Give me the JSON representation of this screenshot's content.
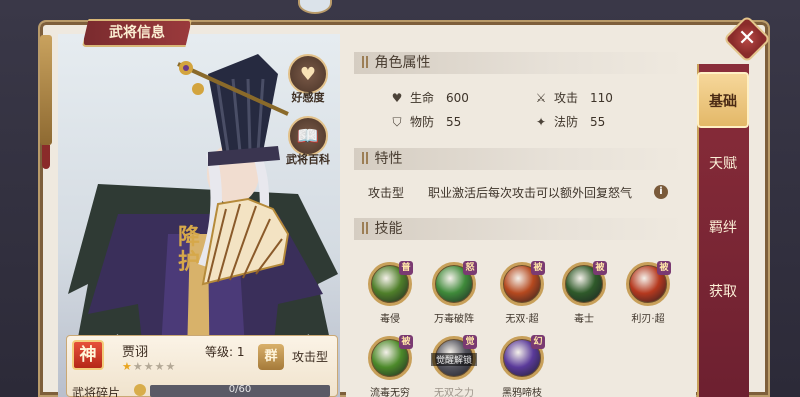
{
  "window": {
    "title": "武将信息"
  },
  "side_buttons": {
    "favor": "好感度",
    "encyclopedia": "武将百科"
  },
  "hero": {
    "god_badge": "神",
    "name": "贾诩",
    "level_label": "等级:",
    "level": "1",
    "stars_filled": 1,
    "stars_total": 5,
    "role_badge": "群",
    "role": "攻击型",
    "fragment_label": "武将碎片",
    "fragment_text": "0/60",
    "fragment_progress": 0
  },
  "sections": {
    "attributes": "角色属性",
    "trait": "特性",
    "skills": "技能"
  },
  "attributes": [
    {
      "icon": "heart-icon",
      "glyph": "♥",
      "label": "生命",
      "value": "600"
    },
    {
      "icon": "sword-icon",
      "glyph": "⚔",
      "label": "攻击",
      "value": "110"
    },
    {
      "icon": "shield-icon",
      "glyph": "⛉",
      "label": "物防",
      "value": "55"
    },
    {
      "icon": "magic-icon",
      "glyph": "✦",
      "label": "法防",
      "value": "55"
    }
  ],
  "trait": {
    "label": "攻击型",
    "desc": "职业激活后每次攻击可以额外回复怒气"
  },
  "skills": [
    {
      "name": "毒侵",
      "tag": "普",
      "color": "#4f7f2a"
    },
    {
      "name": "万毒破阵",
      "tag": "怒",
      "color": "#3f8a3a"
    },
    {
      "name": "无双·超",
      "tag": "被",
      "color": "#b5491f"
    },
    {
      "name": "毒士",
      "tag": "被",
      "color": "#2f5a2a"
    },
    {
      "name": "利刃·超",
      "tag": "被",
      "color": "#b5391f"
    },
    {
      "name": "流毒无穷",
      "tag": "被",
      "color": "#4c8a2a"
    },
    {
      "name": "无双之力",
      "tag": "觉",
      "color": "#55555f",
      "overlay": "觉醒解锁",
      "dim": true
    },
    {
      "name": "黑鸦啼枝",
      "tag": "幻",
      "color": "#5a3a9a"
    }
  ],
  "tabs": [
    "基础",
    "天赋",
    "羁绊",
    "获取"
  ],
  "active_tab": "基础",
  "colors": {
    "accent": "#8a2d3a",
    "gold": "#c8a05a",
    "paper": "#efe9df"
  }
}
